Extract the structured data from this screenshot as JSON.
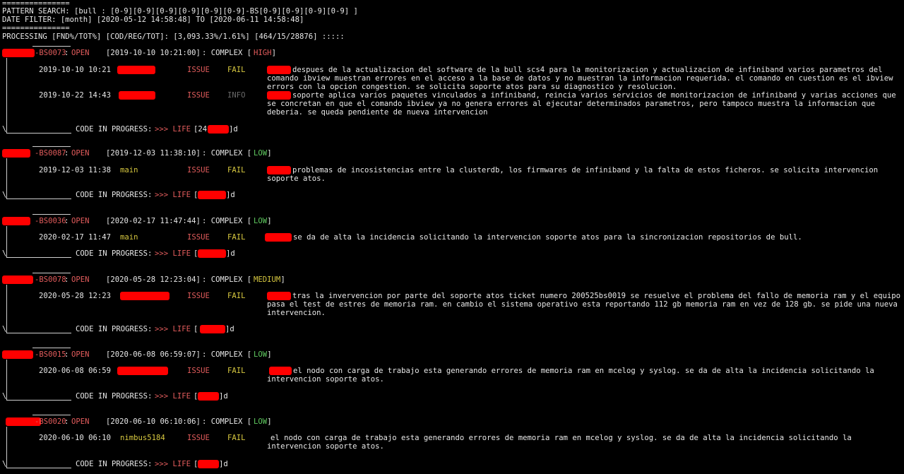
{
  "header": {
    "rule_top": "===============",
    "pattern_search": "PATTERN SEARCH: [bull : [0-9][0-9][0-9][0-9][0-9][0-9]-BS[0-9][0-9][0-9][0-9] ]",
    "date_filter": "DATE FILTER: [month] [2020-05-12 14:58:48] TO [2020-06-11 14:58:48]",
    "rule_bottom": "===============",
    "processing": "PROCESSING [FND%/TOT%] [COD/REG/TOT]: [3,093.33%/1.61%] [464/15/28876] :::::"
  },
  "tickets": [
    {
      "id": "BS0073",
      "status_label": "OPEN",
      "date": "[2019-10-10 10:21:00]",
      "complex_prefix": ": COMPLEX [",
      "complex": "HIGH",
      "complex_suffix": "]",
      "entries": [
        {
          "datetime": "2019-10-10 10:21",
          "user": "",
          "type": "ISSUE",
          "result": "FAIL",
          "desc": [
            "despues de la actualizacion del software de la bull scs4 para la monitorizacion y actualizacion de infiniband varios parametros del",
            "comando ibview muestran errores en el acceso a la base de datos y no muestran la informacion requerida. el comando en cuestion es el ibview",
            "errors con la opcion congestion. se solicita soporte atos para su diagnostico y resolucion."
          ]
        },
        {
          "datetime": "2019-10-22 14:43",
          "user": "",
          "type": "ISSUE",
          "result": "INFO",
          "desc": [
            "soporte aplica varios paquetes vinculados a infiniband, reincia varios servicios de monitorizacion de infiniband y varias acciones que",
            "se concretan en que el comando ibview ya no genera errores al ejecutar determinados parametros, pero tampoco muestra la informacion que",
            "deberia. se queda pendiente de nueva intervencion"
          ]
        }
      ],
      "footer_code": "CODE IN PROGRESS:",
      "footer_life": ">>> LIFE",
      "life_open": "[24",
      "life_close": "]d"
    },
    {
      "id": "BS0087",
      "status_label": "OPEN",
      "date": "[2019-12-03 11:38:10]",
      "complex_prefix": ": COMPLEX [",
      "complex": "LOW",
      "complex_suffix": "]",
      "entries": [
        {
          "datetime": "2019-12-03 11:38",
          "user": "main",
          "type": "ISSUE",
          "result": "FAIL",
          "desc": [
            "problemas de incosistencias entre la clusterdb, los firmwares de infiniband y la falta de estos ficheros. se solicita intervencion",
            "soporte atos."
          ]
        }
      ],
      "footer_code": "CODE IN PROGRESS:",
      "footer_life": ">>> LIFE",
      "life_open": "[",
      "life_close": "]d"
    },
    {
      "id": "BS0036",
      "status_label": "OPEN",
      "date": "[2020-02-17 11:47:44]",
      "complex_prefix": ": COMPLEX [",
      "complex": "LOW",
      "complex_suffix": "]",
      "entries": [
        {
          "datetime": "2020-02-17 11:47",
          "user": "main",
          "type": "ISSUE",
          "result": "FAIL",
          "desc": [
            "se da de alta la incidencia solicitando la intervencion soporte atos para la sincronizacion repositorios de bull."
          ]
        }
      ],
      "footer_code": "CODE IN PROGRESS:",
      "footer_life": ">>> LIFE",
      "life_open": "[",
      "life_close": "]d"
    },
    {
      "id": "BS0078",
      "status_label": "OPEN",
      "date": "[2020-05-28 12:23:04]",
      "complex_prefix": ": COMPLEX [",
      "complex": "MEDIUM",
      "complex_suffix": "]",
      "entries": [
        {
          "datetime": "2020-05-28 12:23",
          "user": "",
          "type": "ISSUE",
          "result": "FAIL",
          "desc": [
            "tras la invervencion por parte del soporte atos ticket numero 200525bs0019 se resuelve el problema del fallo de memoria ram y el equipo",
            "pasa el test de estres de memoria ram. en cambio el sistema operativo esta reportando 112 gb memoria ram en vez de 128 gb. se pide una nueva",
            "intervencion."
          ]
        }
      ],
      "footer_code": "CODE IN PROGRESS:",
      "footer_life": ">>> LIFE",
      "life_open": "[",
      "life_close": "]d"
    },
    {
      "id": "BS0015",
      "status_label": "OPEN",
      "date": "[2020-06-08 06:59:07]",
      "complex_prefix": ": COMPLEX [",
      "complex": "LOW",
      "complex_suffix": "]",
      "entries": [
        {
          "datetime": "2020-06-08 06:59",
          "user": "",
          "type": "ISSUE",
          "result": "FAIL",
          "desc": [
            "el nodo con carga de trabajo esta generando errores de memoria ram en mcelog y syslog. se da de alta la incidencia solicitando la",
            "intervencion soporte atos."
          ]
        }
      ],
      "footer_code": "CODE IN PROGRESS:",
      "footer_life": ">>> LIFE",
      "life_open": "[",
      "life_close": "]d"
    },
    {
      "id": "BS0020",
      "status_label": "OPEN",
      "date": "[2020-06-10 06:10:06]",
      "complex_prefix": ": COMPLEX [",
      "complex": "LOW",
      "complex_suffix": "]",
      "entries": [
        {
          "datetime": "2020-06-10 06:10",
          "user": "nimbus5184",
          "type": "ISSUE",
          "result": "FAIL",
          "desc": [
            "el nodo con carga de trabajo esta generando errores de memoria ram en mcelog y syslog. se da de alta la incidencia solicitando la",
            "intervencion soporte atos."
          ]
        }
      ],
      "footer_code": "CODE IN PROGRESS:",
      "footer_life": ">>> LIFE",
      "life_open": "[",
      "life_close": "]d"
    }
  ],
  "colors": {
    "red": "#e25c5c",
    "yellow": "#d8c940",
    "green": "#5fc95f",
    "redaction": "#ff0000"
  }
}
